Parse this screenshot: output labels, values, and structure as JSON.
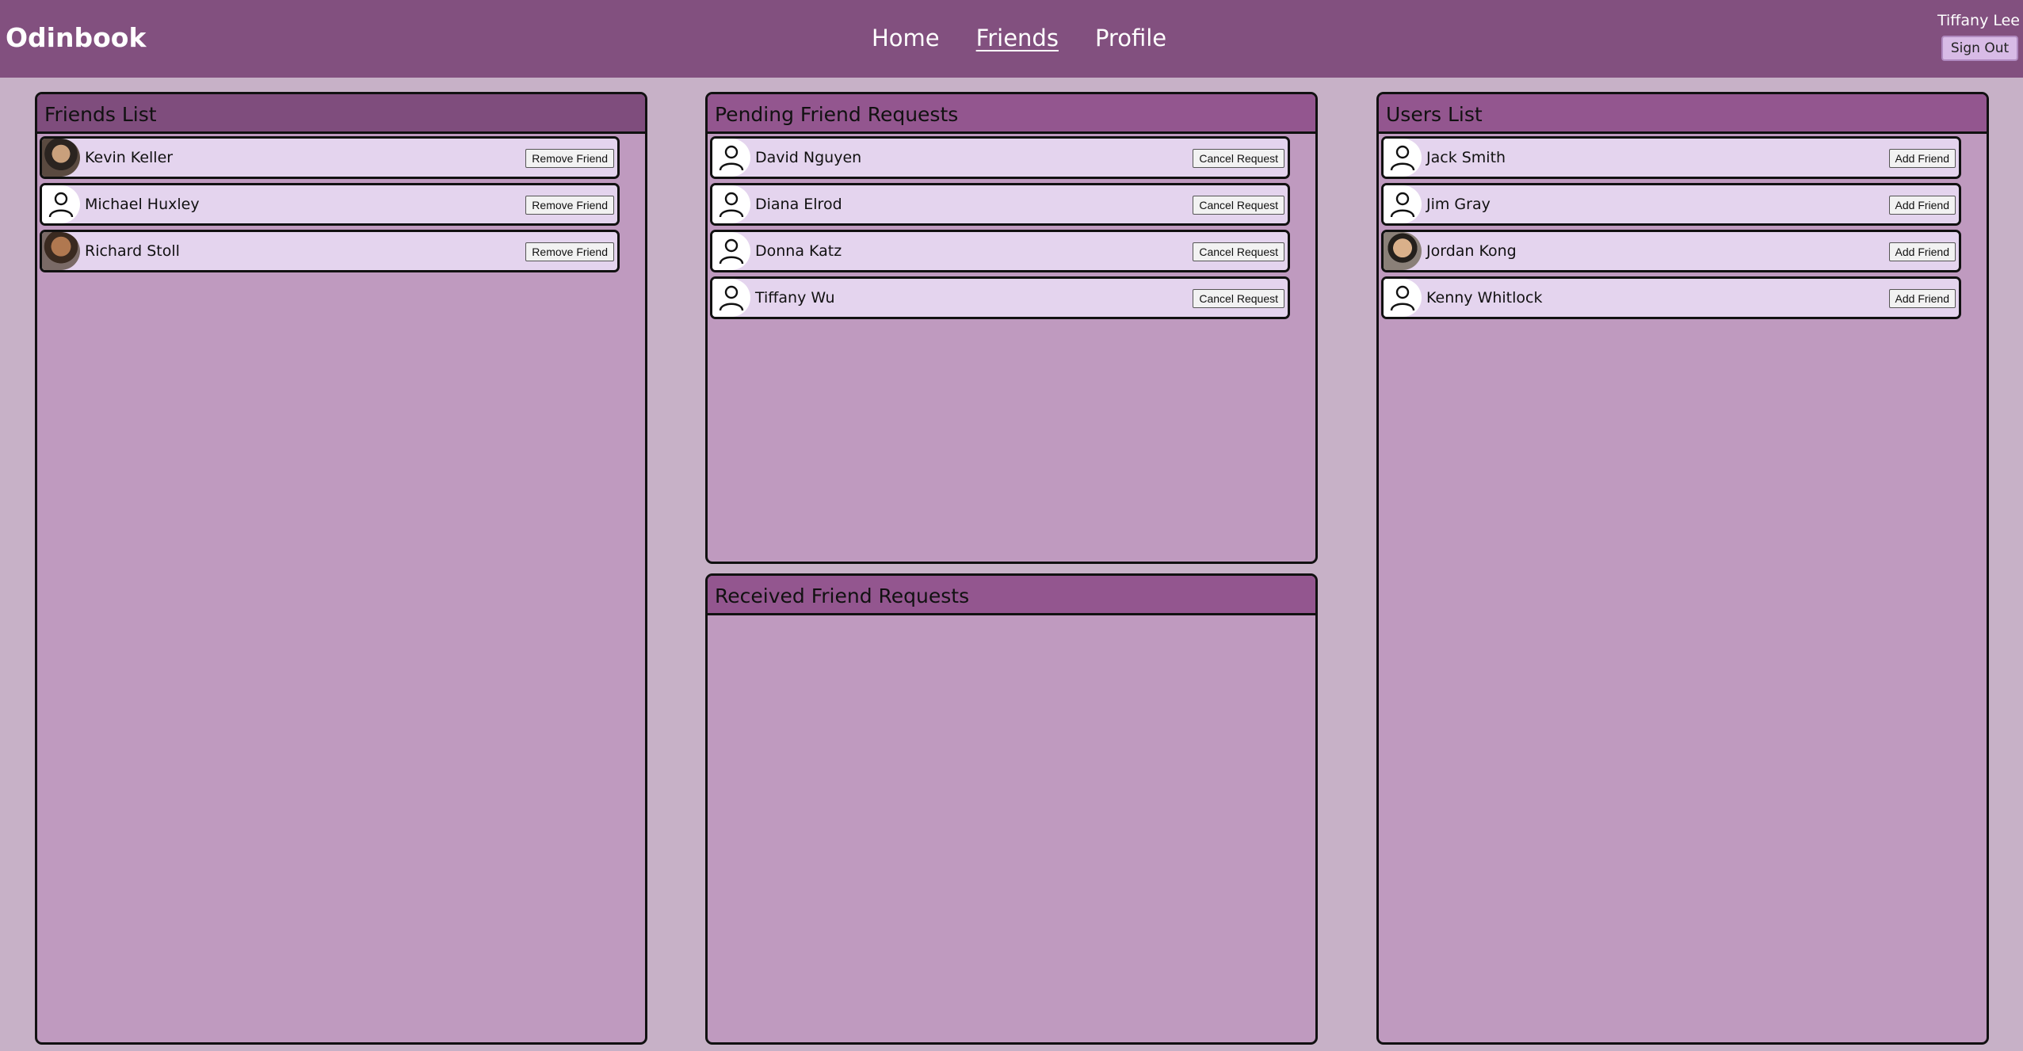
{
  "header": {
    "brand": "Odinbook",
    "nav": [
      "Home",
      "Friends",
      "Profile"
    ],
    "active_nav": "Friends",
    "user_name": "Tiffany Lee",
    "signout_label": "Sign Out"
  },
  "friends_list": {
    "title": "Friends List",
    "button_label": "Remove Friend",
    "items": [
      {
        "name": "Kevin Keller",
        "avatar": "photo"
      },
      {
        "name": "Michael Huxley",
        "avatar": "default-user-icon"
      },
      {
        "name": "Richard Stoll",
        "avatar": "photo"
      }
    ]
  },
  "pending_requests": {
    "title": "Pending Friend Requests",
    "button_label": "Cancel Request",
    "items": [
      {
        "name": "David Nguyen",
        "avatar": "default-user-icon"
      },
      {
        "name": "Diana Elrod",
        "avatar": "default-user-icon"
      },
      {
        "name": "Donna Katz",
        "avatar": "default-user-icon"
      },
      {
        "name": "Tiffany Wu",
        "avatar": "default-user-icon"
      }
    ]
  },
  "received_requests": {
    "title": "Received Friend Requests",
    "items": []
  },
  "users_list": {
    "title": "Users List",
    "button_label": "Add Friend",
    "items": [
      {
        "name": "Jack Smith",
        "avatar": "default-user-icon"
      },
      {
        "name": "Jim Gray",
        "avatar": "default-user-icon"
      },
      {
        "name": "Jordan Kong",
        "avatar": "photo"
      },
      {
        "name": "Kenny Whitlock",
        "avatar": "default-user-icon"
      }
    ]
  },
  "colors": {
    "header_bg": "#82507f",
    "page_bg": "#c7b1c7",
    "panel_bg": "#bf9abf",
    "panel_head": "#93568f",
    "row_bg": "#e4d4ee",
    "signout_bg": "#d8bbe6"
  }
}
